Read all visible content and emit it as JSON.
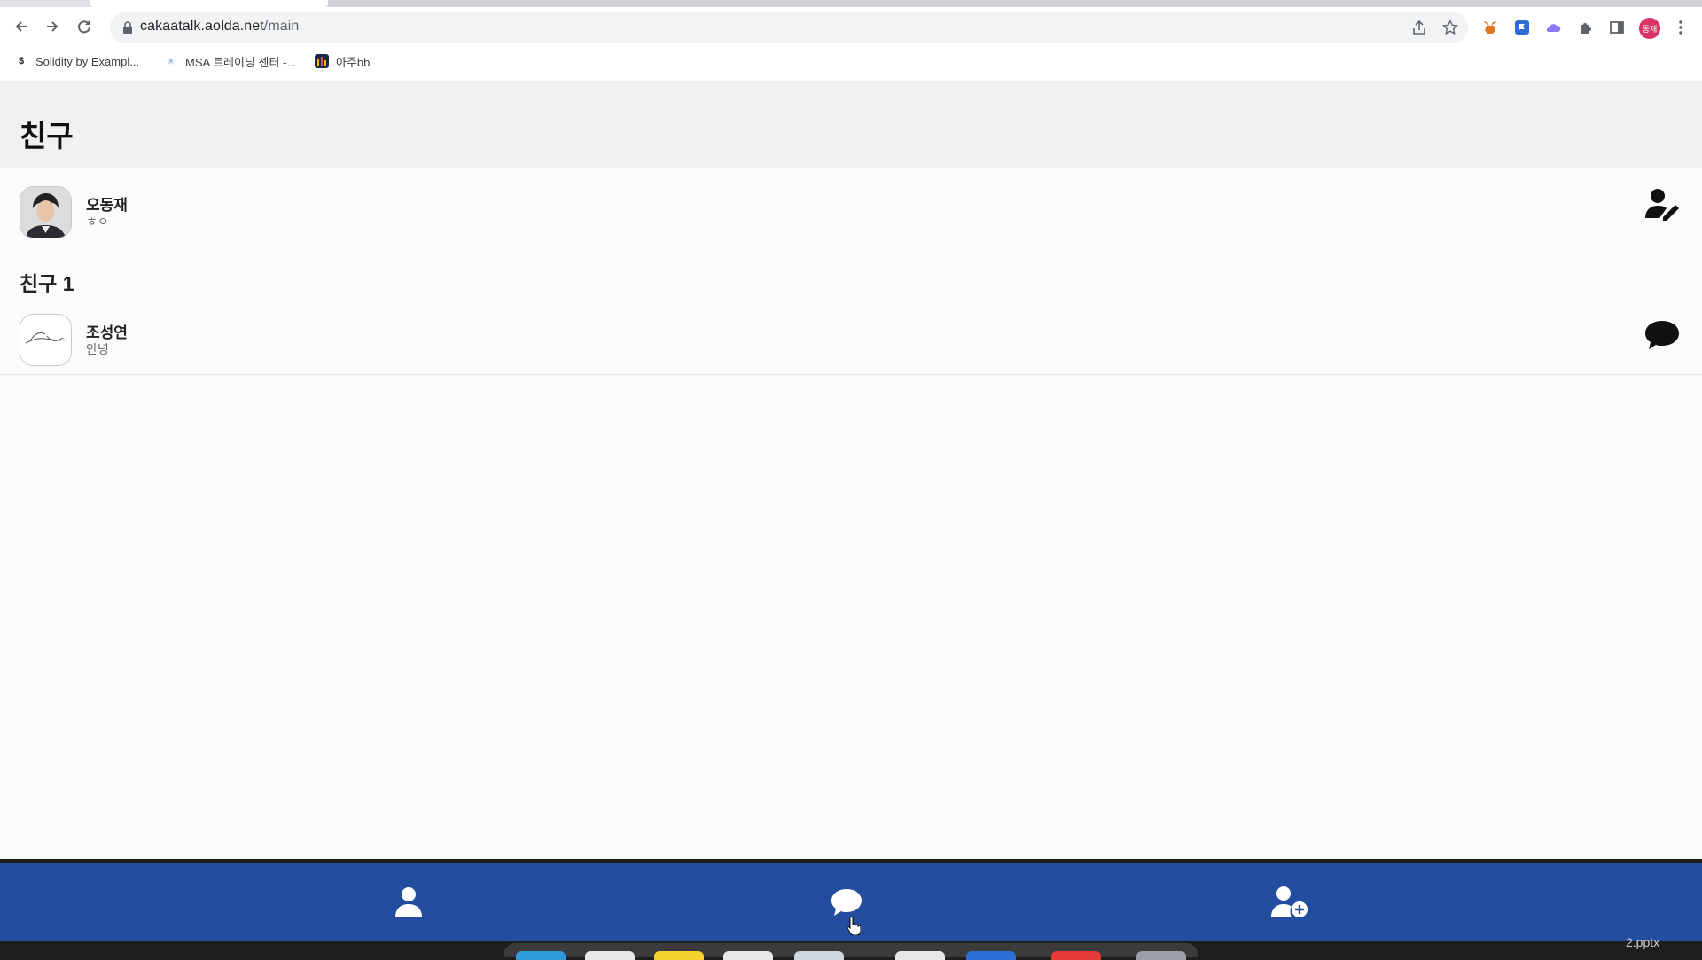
{
  "browser": {
    "url_host": "cakaatalk.aolda.net",
    "url_path": "/main",
    "profile_badge": "동재",
    "bookmarks": [
      {
        "label": "Solidity by Exampl...",
        "icon": "solidity-icon"
      },
      {
        "label": "MSA 트레이닝 센터 -...",
        "icon": "msa-icon"
      },
      {
        "label": "아주bb",
        "icon": "ajoubb-icon"
      }
    ]
  },
  "app": {
    "title": "친구",
    "me": {
      "name": "오동재",
      "status": "ㅎㅇ",
      "action_icon": "edit-profile-icon"
    },
    "friends_section_label": "친구 1",
    "friends": [
      {
        "name": "조성연",
        "status": "안녕",
        "action_icon": "chat-bubble-icon"
      }
    ],
    "bottom_nav": [
      {
        "icon": "person-icon"
      },
      {
        "icon": "chat-bubble-icon"
      },
      {
        "icon": "add-friend-icon"
      }
    ],
    "colors": {
      "nav_bg": "#234e9f",
      "header_bg": "#f1f1f1"
    }
  },
  "desktop": {
    "dock_label": "2.pptx"
  }
}
